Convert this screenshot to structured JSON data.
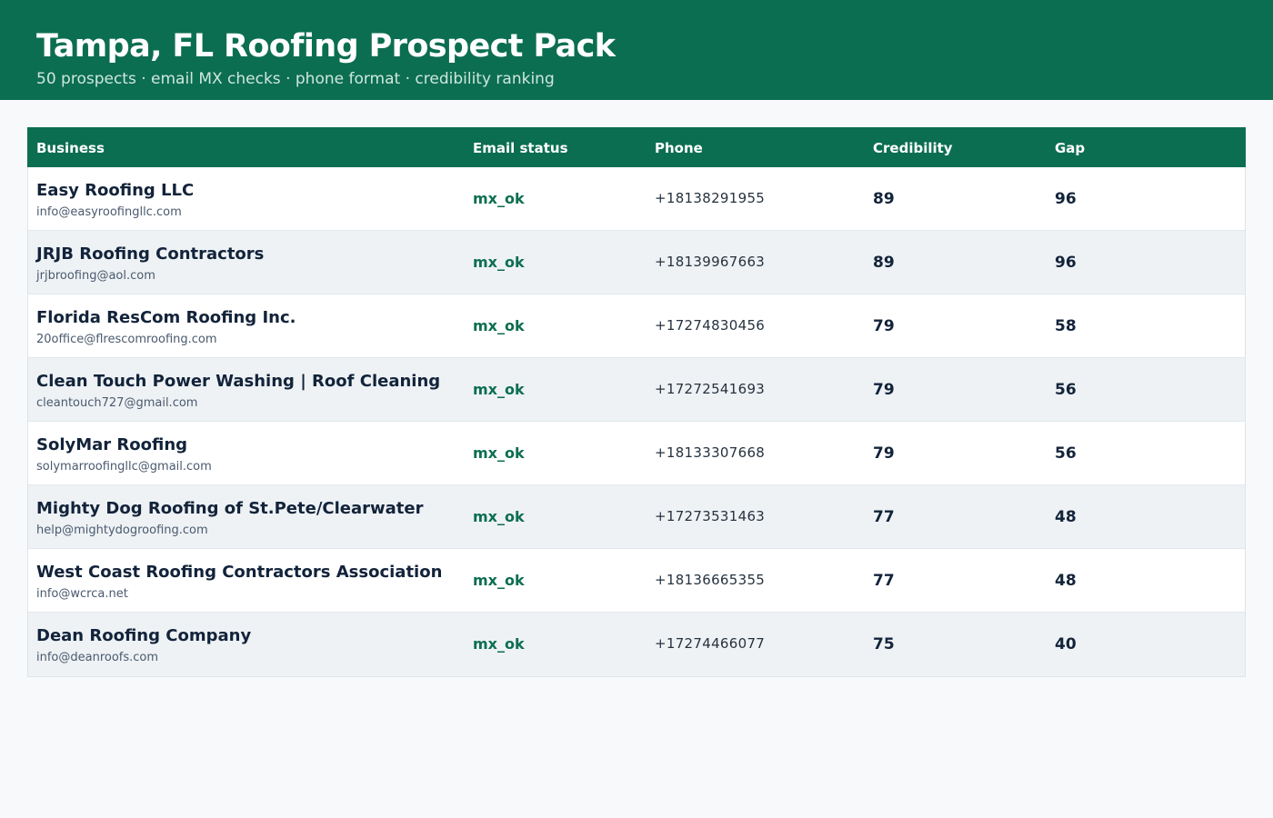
{
  "header": {
    "title": "Tampa, FL Roofing Prospect Pack",
    "subtitle": "50 prospects · email MX checks · phone format · credibility ranking"
  },
  "colors": {
    "brand": "#0c6e51",
    "status_ok": "#0c6e51",
    "text_dark": "#12233a",
    "row_alt": "#eef2f5"
  },
  "table": {
    "columns": [
      "Business",
      "Email status",
      "Phone",
      "Credibility",
      "Gap"
    ],
    "rows": [
      {
        "name": "Easy Roofing LLC",
        "email": "info@easyroofingllc.com",
        "status": "mx_ok",
        "phone": "+18138291955",
        "credibility": "89",
        "gap": "96"
      },
      {
        "name": "JRJB Roofing Contractors",
        "email": "jrjbroofing@aol.com",
        "status": "mx_ok",
        "phone": "+18139967663",
        "credibility": "89",
        "gap": "96"
      },
      {
        "name": "Florida ResCom Roofing Inc.",
        "email": "20office@flrescomroofing.com",
        "status": "mx_ok",
        "phone": "+17274830456",
        "credibility": "79",
        "gap": "58"
      },
      {
        "name": "Clean Touch Power Washing | Roof Cleaning",
        "email": "cleantouch727@gmail.com",
        "status": "mx_ok",
        "phone": "+17272541693",
        "credibility": "79",
        "gap": "56"
      },
      {
        "name": "SolyMar Roofing",
        "email": "solymarroofingllc@gmail.com",
        "status": "mx_ok",
        "phone": "+18133307668",
        "credibility": "79",
        "gap": "56"
      },
      {
        "name": "Mighty Dog Roofing of St.Pete/Clearwater",
        "email": "help@mightydogroofing.com",
        "status": "mx_ok",
        "phone": "+17273531463",
        "credibility": "77",
        "gap": "48"
      },
      {
        "name": "West Coast Roofing Contractors Association",
        "email": "info@wcrca.net",
        "status": "mx_ok",
        "phone": "+18136665355",
        "credibility": "77",
        "gap": "48"
      },
      {
        "name": "Dean Roofing Company",
        "email": "info@deanroofs.com",
        "status": "mx_ok",
        "phone": "+17274466077",
        "credibility": "75",
        "gap": "40"
      }
    ]
  }
}
